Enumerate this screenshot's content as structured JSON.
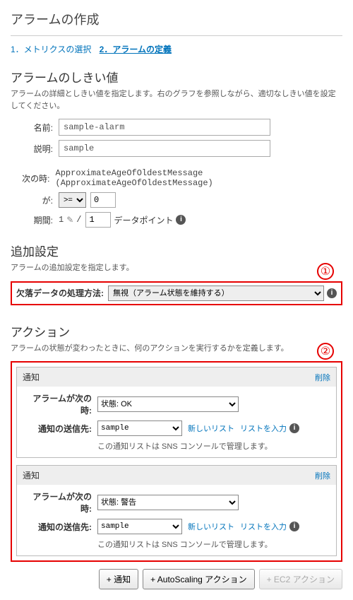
{
  "page_title": "アラームの作成",
  "steps": {
    "s1": "1．メトリクスの選択",
    "s2": "2．アラームの定義"
  },
  "threshold": {
    "heading": "アラームのしきい値",
    "desc": "アラームの詳細としきい値を指定します。右のグラフを参照しながら、適切なしきい値を設定してください。",
    "name_label": "名前:",
    "name_value": "sample-alarm",
    "desc_label": "説明:",
    "desc_value": "sample",
    "when_label": "次の時:",
    "when_value": "ApproximateAgeOfOldestMessage (ApproximateAgeOfOldestMessage)",
    "is_label": "が:",
    "operator": ">=",
    "threshold_value": "0",
    "period_label": "期間:",
    "period_n1": "1",
    "period_slash": "/",
    "period_n2": "1",
    "period_unit": "データポイント"
  },
  "additional": {
    "heading": "追加設定",
    "desc": "アラームの追加設定を指定します。",
    "missing_label": "欠落データの処理方法:",
    "missing_value": "無視（アラーム状態を維持する）"
  },
  "actions": {
    "heading": "アクション",
    "desc": "アラームの状態が変わったときに、何のアクションを実行するかを定義します。",
    "notify_label": "通知",
    "delete_label": "削除",
    "when_label": "アラームが次の時:",
    "dest_label": "通知の送信先:",
    "new_list": "新しいリスト",
    "enter_list": "リストを入力",
    "sns_note": "この通知リストは SNS コンソールで管理します。",
    "blocks": [
      {
        "state": "状態: OK",
        "dest": "sample"
      },
      {
        "state": "状態: 警告",
        "dest": "sample"
      }
    ]
  },
  "buttons": {
    "add_notify": "+ 通知",
    "add_as": "+ AutoScaling アクション",
    "add_ec2": "+ EC2 アクション"
  },
  "callouts": {
    "c1": "①",
    "c2": "②"
  }
}
